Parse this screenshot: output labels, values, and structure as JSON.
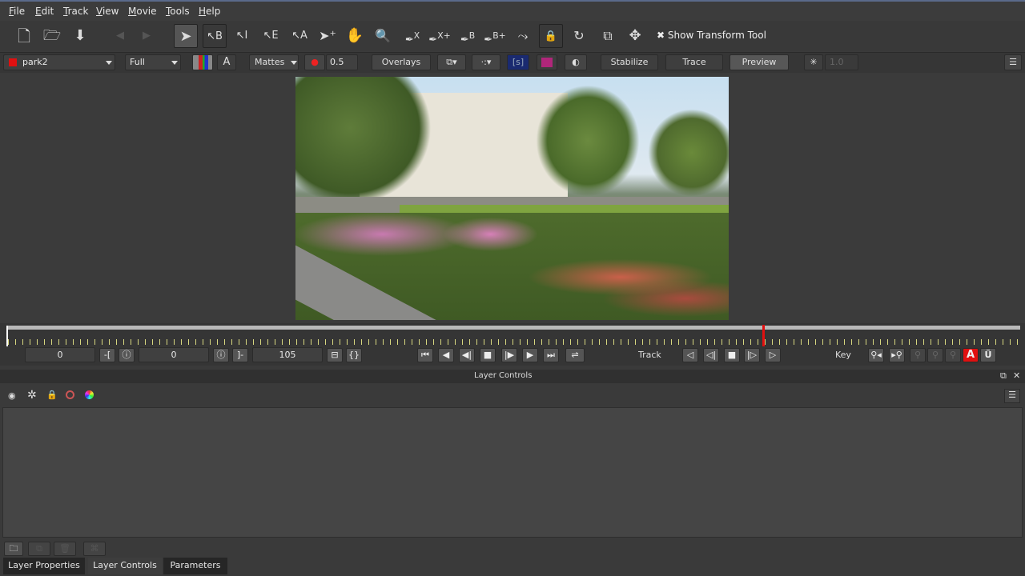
{
  "menu": [
    "File",
    "Edit",
    "Track",
    "View",
    "Movie",
    "Tools",
    "Help"
  ],
  "toolbar": {
    "tools": [
      "select",
      "select-B",
      "select-I",
      "select-E",
      "select-A",
      "add-point",
      "hand",
      "zoom",
      "pen-X",
      "pen-X+",
      "pen-B",
      "pen-B+",
      "curve",
      "lock",
      "rotate",
      "scale",
      "move"
    ],
    "tool_letters": {
      "select-B": "B",
      "select-I": "I",
      "select-E": "E",
      "select-A": "A",
      "pen-X": "X",
      "pen-X+": "X+",
      "pen-B": "B",
      "pen-B+": "B+"
    },
    "show_transform_tool": "Show Transform Tool",
    "show_transform_checked": true
  },
  "toolbar2": {
    "layer": "park2",
    "layer_color": "#e01010",
    "view_mode": "Full",
    "channel_alpha": "A",
    "mattes": "Mattes",
    "opacity": "0.5",
    "overlays": "Overlays",
    "stabilize": "Stabilize",
    "trace": "Trace",
    "preview": "Preview",
    "zoom_value": "1.0"
  },
  "timeline": {
    "current_frame_fraction": 0.746,
    "in_frame": "0",
    "current_frame": "0",
    "out_frame": "105",
    "track_label": "Track",
    "key_label": "Key"
  },
  "layer_controls": {
    "title": "Layer Controls"
  },
  "bottom_tabs": [
    {
      "label": "Layer Properties",
      "active": false
    },
    {
      "label": "Layer Controls",
      "active": true
    },
    {
      "label": "Parameters",
      "active": false
    }
  ],
  "colors": {
    "accent_red": "#e01010",
    "tick_yellow": "#d8d880"
  }
}
